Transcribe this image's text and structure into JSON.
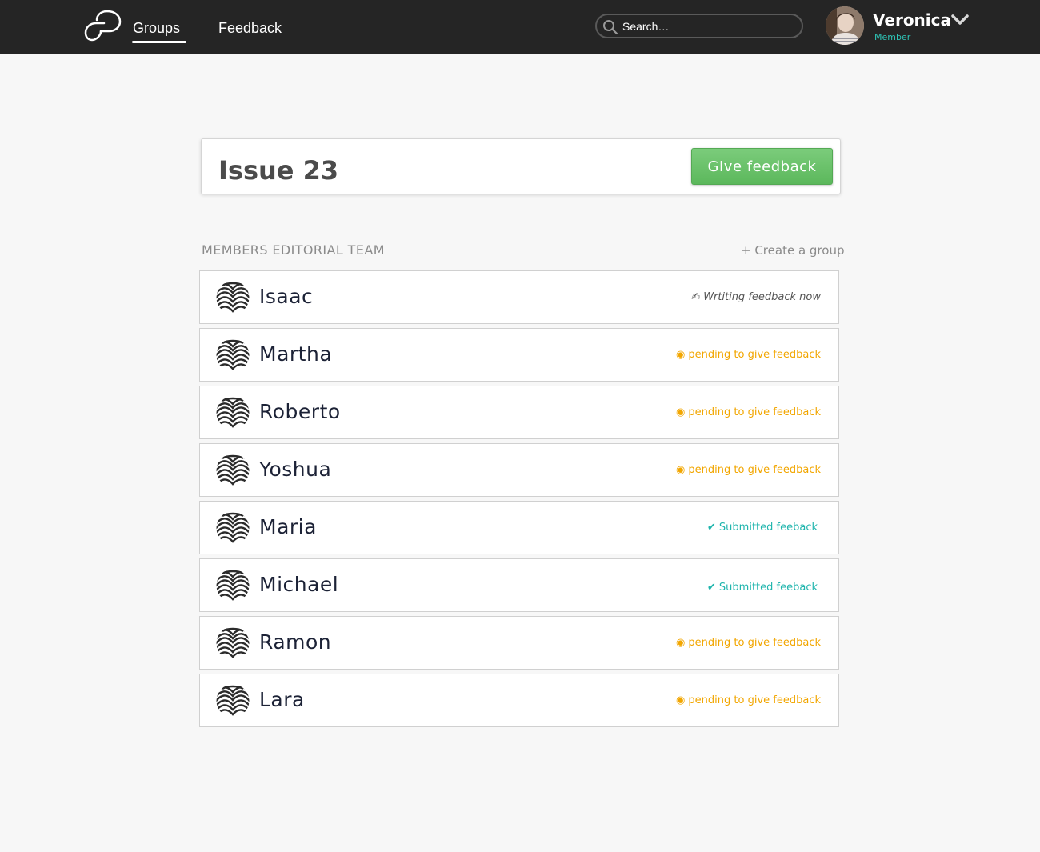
{
  "header": {
    "nav": [
      {
        "label": "Groups",
        "active": true
      },
      {
        "label": "Feedback",
        "active": false
      }
    ],
    "search": {
      "placeholder": "Search…",
      "value": ""
    },
    "user": {
      "name": "Veronica",
      "role": "Member"
    }
  },
  "issue": {
    "title": "Issue 23",
    "give_feedback_label": "GIve feedback"
  },
  "members_section": {
    "title": "MEMBERS EDITORIAL TEAM",
    "create_group_label": "+ Create a group"
  },
  "members": [
    {
      "name": "Isaac",
      "status": "✍ Wrtiting feedback now",
      "status_type": "writing"
    },
    {
      "name": "Martha",
      "status": "◉ pending to give feedback",
      "status_type": "pending"
    },
    {
      "name": "Roberto",
      "status": "◉ pending to give feedback",
      "status_type": "pending"
    },
    {
      "name": "Yoshua",
      "status": "◉ pending to give feedback",
      "status_type": "pending"
    },
    {
      "name": "Maria",
      "status": "✔ Submitted feeback",
      "status_type": "submitted"
    },
    {
      "name": "Michael",
      "status": "✔ Submitted feeback",
      "status_type": "submitted"
    },
    {
      "name": "Ramon",
      "status": "◉ pending to give feedback",
      "status_type": "pending"
    },
    {
      "name": "Lara",
      "status": "◉ pending to give feedback",
      "status_type": "pending"
    }
  ],
  "colors": {
    "topbar": "#252525",
    "accent_teal": "#2ec4b6",
    "pending": "#f2a600",
    "submitted": "#1fb5ad",
    "button_green": "#6cc36d"
  }
}
